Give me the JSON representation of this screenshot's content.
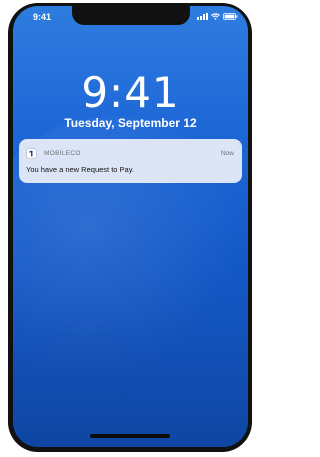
{
  "status_bar": {
    "time": "9:41",
    "icons": [
      "signal-icon",
      "wifi-icon",
      "battery-icon"
    ]
  },
  "lock_screen": {
    "time": "9:41",
    "date": "Tuesday, September 12"
  },
  "notification": {
    "app_name": "MOBILECO",
    "time": "Now",
    "message": "You have a new Request to Pay.",
    "app_icon": "mobileco-logo-icon",
    "accent_color": "#2a3a9e"
  },
  "colors": {
    "wallpaper_top": "#2f7ce0",
    "wallpaper_bottom": "#0f46a3",
    "frame": "#111111"
  }
}
